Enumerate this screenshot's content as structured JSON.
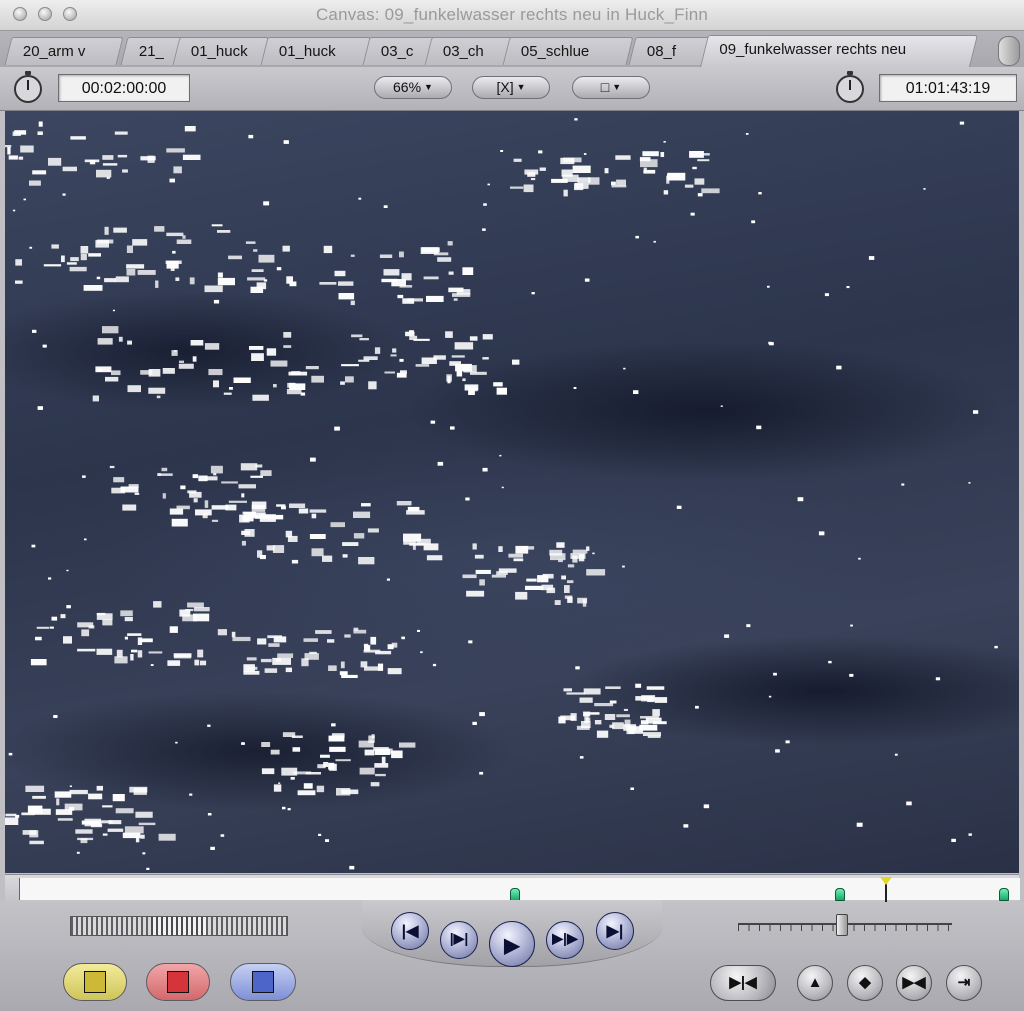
{
  "window": {
    "title": "Canvas: 09_funkelwasser rechts neu in Huck_Finn"
  },
  "tabs": [
    {
      "label": "20_arm v"
    },
    {
      "label": "21_"
    },
    {
      "label": "01_huck"
    },
    {
      "label": "01_huck"
    },
    {
      "label": "03_c"
    },
    {
      "label": "03_ch"
    },
    {
      "label": "05_schlue"
    },
    {
      "label": "08_f"
    },
    {
      "label": "09_funkelwasser rechts neu",
      "active": true
    }
  ],
  "toolbar": {
    "duration_timecode": "00:02:00:00",
    "zoom_label": "66%",
    "view_label": "[X]",
    "overlay_label": "□",
    "current_timecode": "01:01:43:19"
  },
  "scrubber": {
    "markers": [
      "marker",
      "marker",
      "marker"
    ]
  },
  "transport": {
    "buttons": [
      "go-to-previous-edit",
      "play-in-to-out",
      "play",
      "play-around-current",
      "go-to-next-edit"
    ]
  },
  "edit_buttons": [
    "insert",
    "overwrite",
    "replace"
  ],
  "colors": {
    "insert": "#d9cf4a",
    "overwrite": "#d4343a",
    "replace": "#4d64c8",
    "marker": "#22b872",
    "playhead": "#e6d52a"
  }
}
